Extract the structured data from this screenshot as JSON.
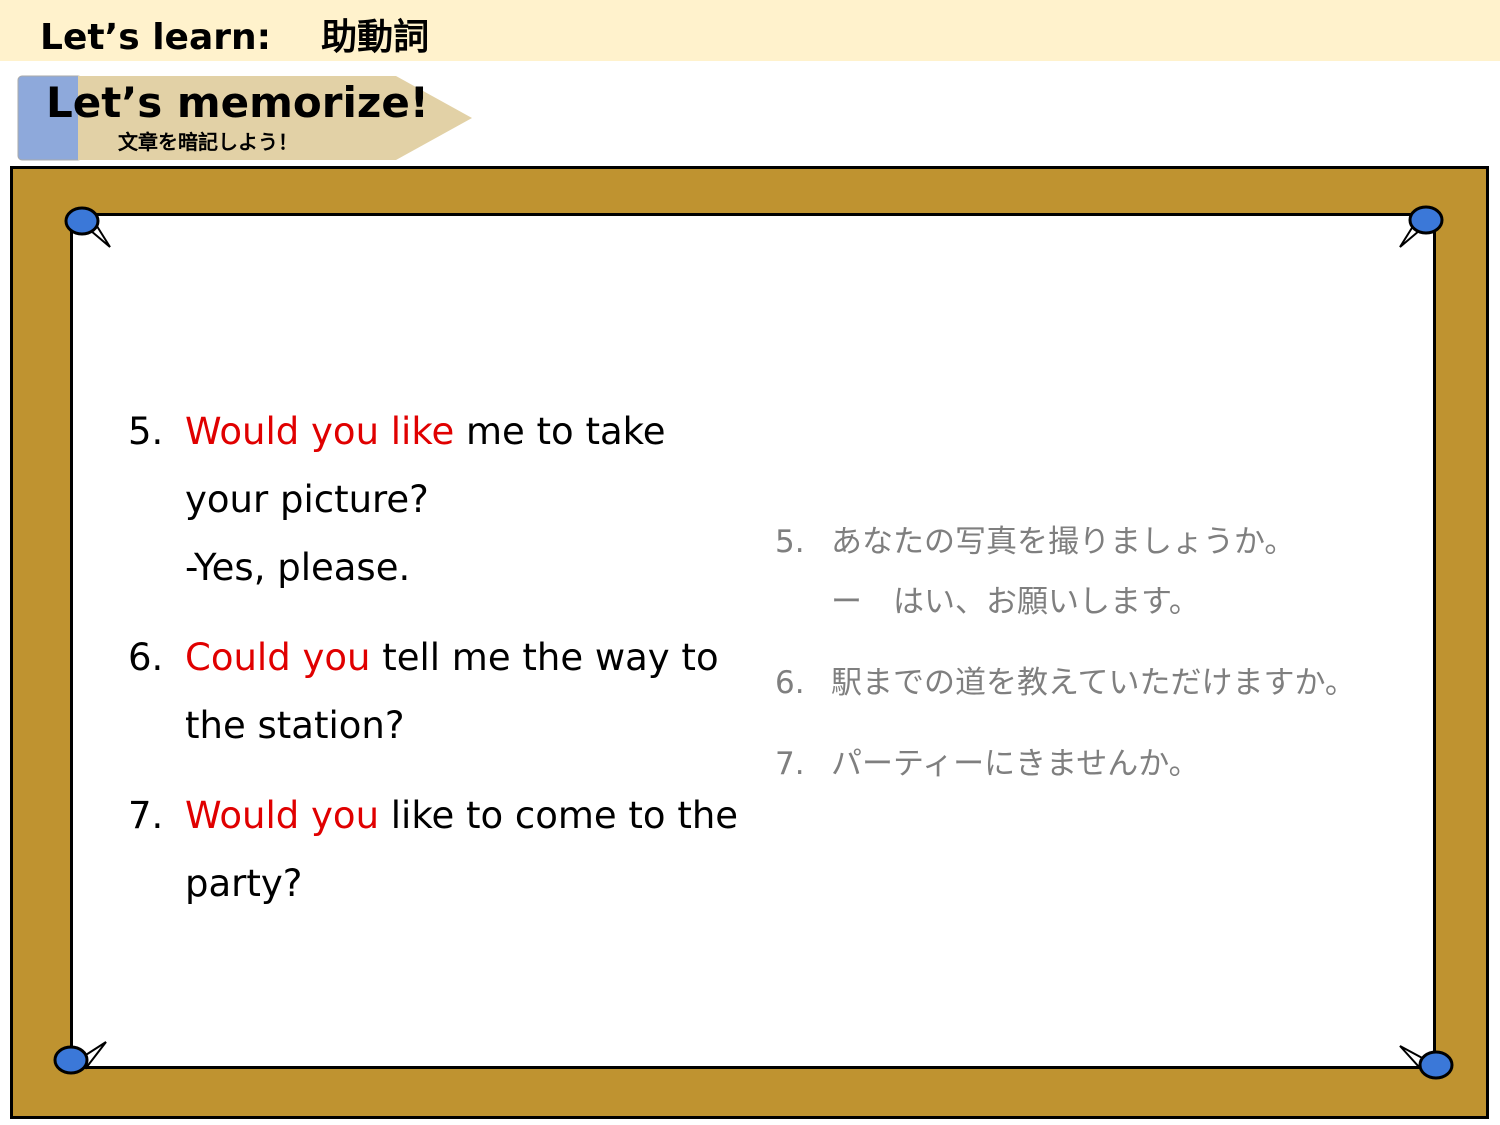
{
  "header": {
    "title": "Let’s learn:    助動詞"
  },
  "banner": {
    "title": "Let’s memorize!",
    "subtitle": "文章を暗記しよう！"
  },
  "english": [
    {
      "number": "5.",
      "highlight": "Would you like",
      "rest": " me to take",
      "lines": [
        "your picture?",
        "-Yes, please."
      ]
    },
    {
      "number": "6.",
      "highlight": "Could you",
      "rest": " tell me the way to",
      "lines": [
        "the station?"
      ]
    },
    {
      "number": "7.",
      "highlight": "Would you",
      "rest": " like to come to the",
      "lines": [
        "party?"
      ]
    }
  ],
  "japanese": [
    {
      "number": "5.",
      "text": "あなたの写真を撮りましょうか。",
      "sub": "ー　はい、お願いします。"
    },
    {
      "number": "6.",
      "text": "駅までの道を教えていただけますか。"
    },
    {
      "number": "7.",
      "text": "パーティーにきませんか。"
    }
  ],
  "colors": {
    "highlight": "#e00000",
    "board": "#bf9330",
    "header": "#fff2cc",
    "japanese_text": "#7f7f7f",
    "pin": "#3b78d8"
  }
}
